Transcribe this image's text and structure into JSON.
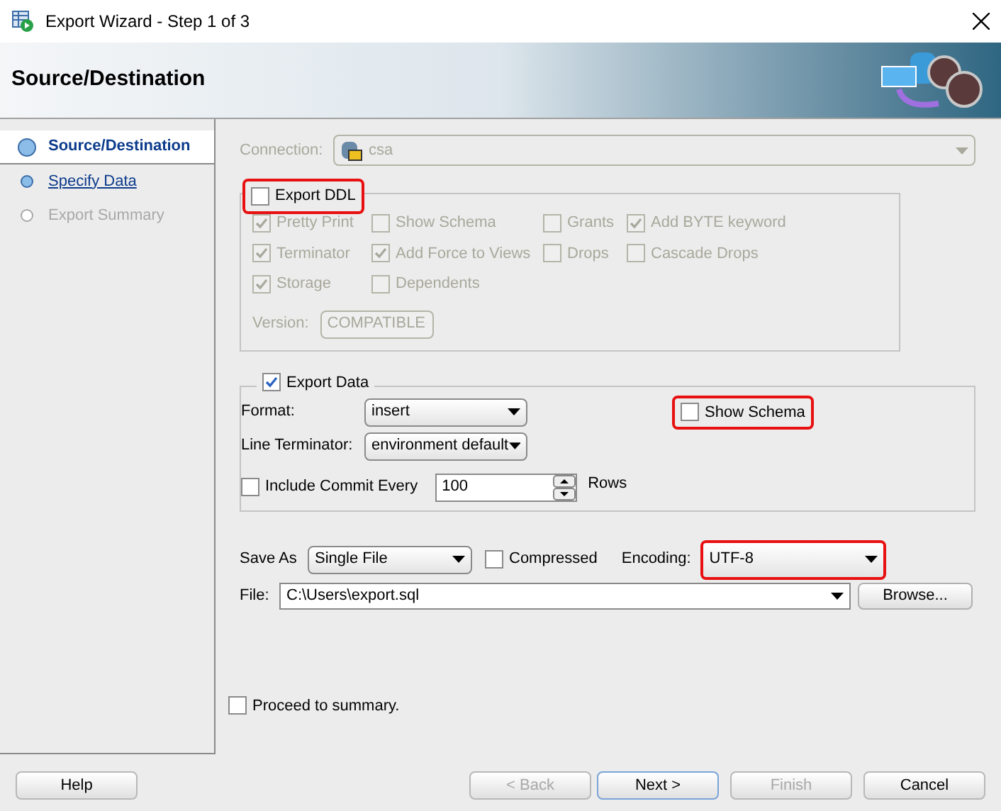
{
  "window": {
    "title": "Export Wizard - Step 1 of 3"
  },
  "header": {
    "title": "Source/Destination"
  },
  "steps": [
    {
      "label": "Source/Destination",
      "kind": "current"
    },
    {
      "label": "Specify Data",
      "kind": "link"
    },
    {
      "label": "Export Summary",
      "kind": "pending"
    }
  ],
  "connection": {
    "label": "Connection:",
    "value": "csa",
    "disabled": true
  },
  "export_ddl": {
    "label": "Export DDL",
    "checked": false,
    "highlighted": true
  },
  "ddl_options": [
    {
      "label": "Pretty Print",
      "checked": true,
      "disabled": true
    },
    {
      "label": "Show Schema",
      "checked": false,
      "disabled": true
    },
    {
      "label": "Grants",
      "checked": false,
      "disabled": true
    },
    {
      "label": "Add BYTE keyword",
      "checked": true,
      "disabled": true
    },
    {
      "label": "Terminator",
      "checked": true,
      "disabled": true
    },
    {
      "label": "Add Force to Views",
      "checked": true,
      "disabled": true
    },
    {
      "label": "Drops",
      "checked": false,
      "disabled": true
    },
    {
      "label": "Cascade Drops",
      "checked": false,
      "disabled": true
    },
    {
      "label": "Storage",
      "checked": true,
      "disabled": true
    },
    {
      "label": "Dependents",
      "checked": false,
      "disabled": true
    }
  ],
  "version": {
    "label": "Version:",
    "value": "COMPATIBLE",
    "disabled": true
  },
  "export_data": {
    "label": "Export Data",
    "checked": true
  },
  "format": {
    "label": "Format:",
    "value": "insert"
  },
  "line_terminator": {
    "label": "Line Terminator:",
    "value": "environment default"
  },
  "show_schema": {
    "label": "Show Schema",
    "checked": false,
    "highlighted": true
  },
  "include_commit": {
    "label": "Include Commit Every",
    "checked": false,
    "value": "100",
    "unit": "Rows"
  },
  "save_as": {
    "label": "Save As",
    "value": "Single File"
  },
  "compressed": {
    "label": "Compressed",
    "checked": false
  },
  "encoding": {
    "label": "Encoding:",
    "value": "UTF-8",
    "highlighted": true
  },
  "file": {
    "label": "File:",
    "value": "C:\\Users\\export.sql",
    "button": "Browse..."
  },
  "proceed": {
    "label": "Proceed to summary.",
    "checked": false
  },
  "buttons": [
    {
      "label": "Help",
      "disabled": false,
      "default": false
    },
    {
      "label": "< Back",
      "disabled": true,
      "default": false
    },
    {
      "label": "Next >",
      "disabled": false,
      "default": true
    },
    {
      "label": "Finish",
      "disabled": true,
      "default": false
    },
    {
      "label": "Cancel",
      "disabled": false,
      "default": false
    }
  ]
}
